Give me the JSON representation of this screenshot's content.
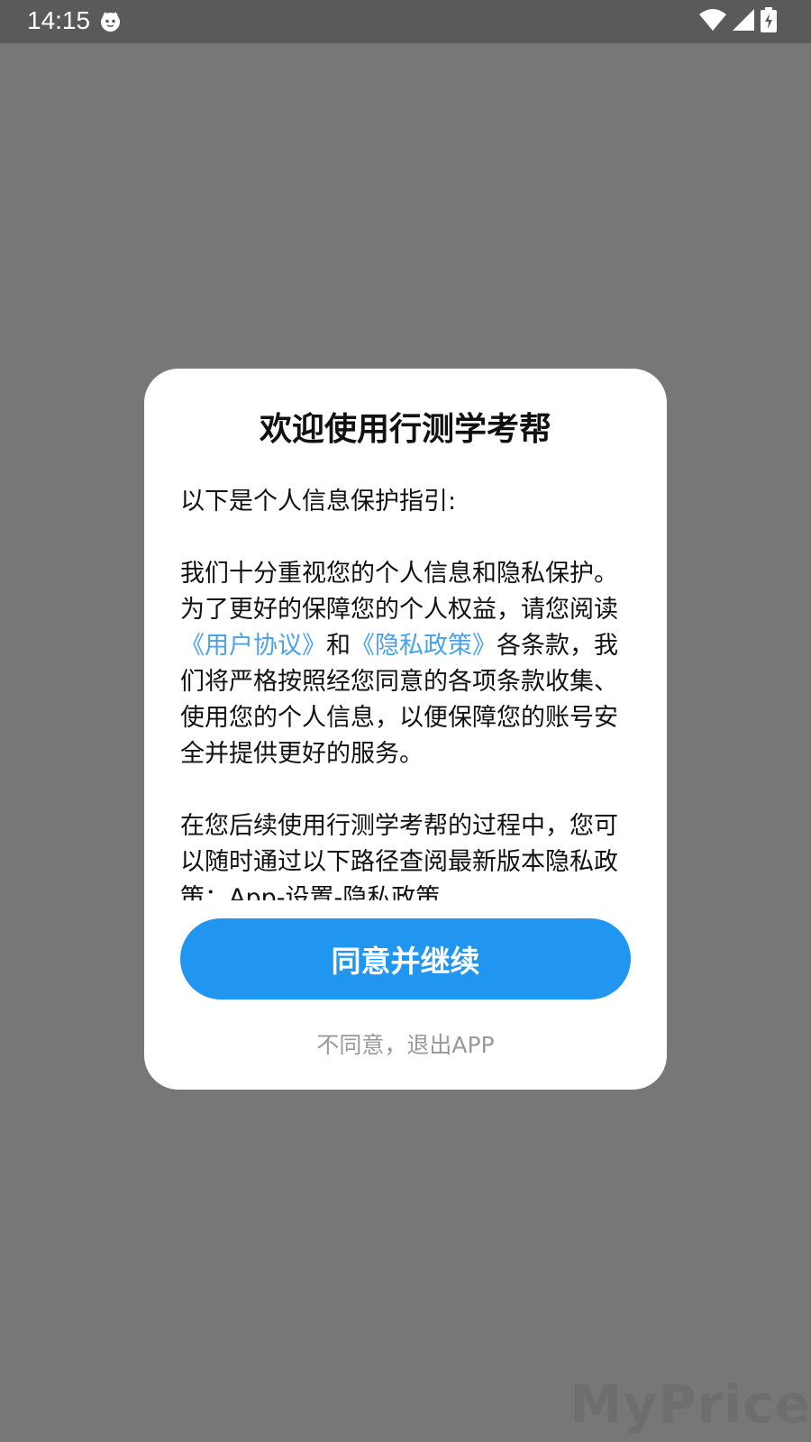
{
  "status_bar": {
    "time": "14:15",
    "app_icon": "cat-face-icon",
    "wifi_icon": "wifi-icon",
    "signal_icon": "signal-icon",
    "battery_icon": "battery-charging-icon"
  },
  "dialog": {
    "title": "欢迎使用行测学考帮",
    "intro": "以下是个人信息保护指引:",
    "para1_a": "我们十分重视您的个人信息和隐私保护。为了更好的保障您的个人权益，请您阅读",
    "user_agreement_link": "《用户协议》",
    "para1_and": "和",
    "privacy_policy_link": "《隐私政策》",
    "para1_b": "各条款，我们将严格按照经您同意的各项条款收集、使用您的个人信息，以便保障您的账号安全并提供更好的服务。",
    "para2": "在您后续使用行测学考帮的过程中，您可以随时通过以下路径查阅最新版本隐私政策：App-设置-隐私政策",
    "agree_button": "同意并继续",
    "disagree_link": "不同意，退出APP"
  },
  "colors": {
    "accent": "#2196f0",
    "link": "#4aa3ea",
    "overlay": "#777777"
  },
  "watermark": "MyPrice"
}
